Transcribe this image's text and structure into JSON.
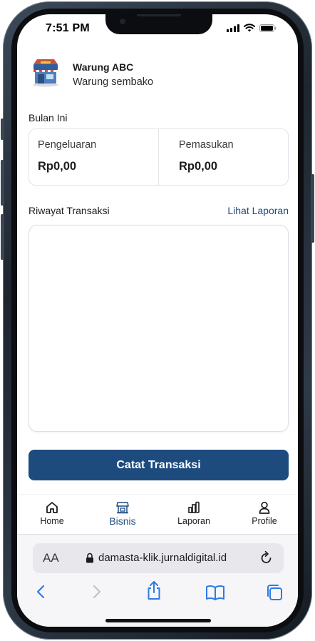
{
  "status_bar": {
    "time": "7:51 PM"
  },
  "business": {
    "name": "Warung ABC",
    "type": "Warung sembako"
  },
  "summary": {
    "title": "Bulan Ini",
    "expense_label": "Pengeluaran",
    "expense_value": "Rp0,00",
    "income_label": "Pemasukan",
    "income_value": "Rp0,00"
  },
  "history": {
    "title": "Riwayat Transaksi",
    "link": "Lihat Laporan"
  },
  "primary_action": {
    "label": "Catat Transaksi"
  },
  "nav": {
    "items": [
      {
        "label": "Home",
        "icon": "home-icon",
        "active": false
      },
      {
        "label": "Bisnis",
        "icon": "store-icon",
        "active": true
      },
      {
        "label": "Laporan",
        "icon": "bar-chart-icon",
        "active": false
      },
      {
        "label": "Profile",
        "icon": "user-icon",
        "active": false
      }
    ]
  },
  "browser": {
    "text_size": "AA",
    "url": "damasta-klik.jurnaldigital.id"
  },
  "colors": {
    "primary": "#1d4b7e",
    "text": "#1c1c1e",
    "border": "#e2e4e8"
  }
}
